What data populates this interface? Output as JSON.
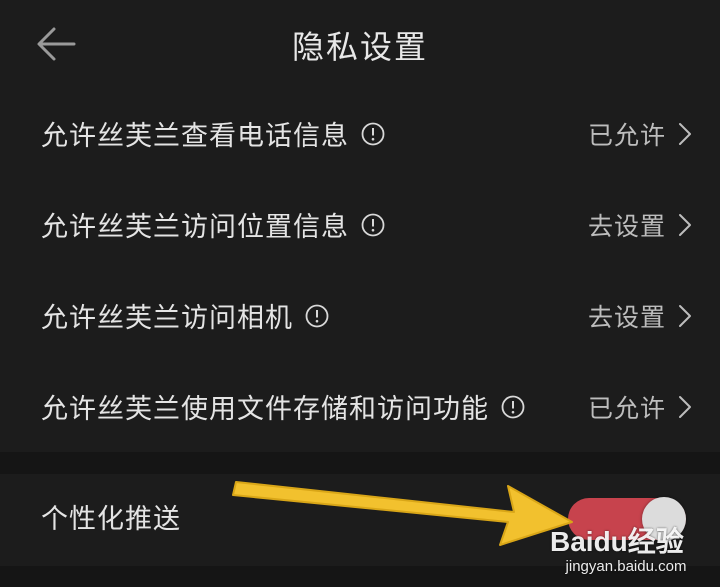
{
  "header": {
    "title": "隐私设置",
    "back_icon": "back-arrow-icon"
  },
  "settings": [
    {
      "label": "允许丝芙兰查看电话信息",
      "value": "已允许",
      "info_icon": "info-icon",
      "chevron_icon": "chevron-right-icon"
    },
    {
      "label": "允许丝芙兰访问位置信息",
      "value": "去设置",
      "info_icon": "info-icon",
      "chevron_icon": "chevron-right-icon"
    },
    {
      "label": "允许丝芙兰访问相机",
      "value": "去设置",
      "info_icon": "info-icon",
      "chevron_icon": "chevron-right-icon"
    },
    {
      "label": "允许丝芙兰使用文件存储和访问功能",
      "value": "已允许",
      "info_icon": "info-icon",
      "chevron_icon": "chevron-right-icon"
    }
  ],
  "personalized_push": {
    "label": "个性化推送",
    "enabled": true
  },
  "watermark": {
    "logo": "Baidu经验",
    "url": "jingyan.baidu.com"
  },
  "colors": {
    "background": "#1b1b1b",
    "row_background": "#1c1c1c",
    "text_primary": "#e4e4e4",
    "text_secondary": "#bdbdbd",
    "toggle_on": "#c7434d",
    "annotation_arrow": "#f2c12e"
  }
}
